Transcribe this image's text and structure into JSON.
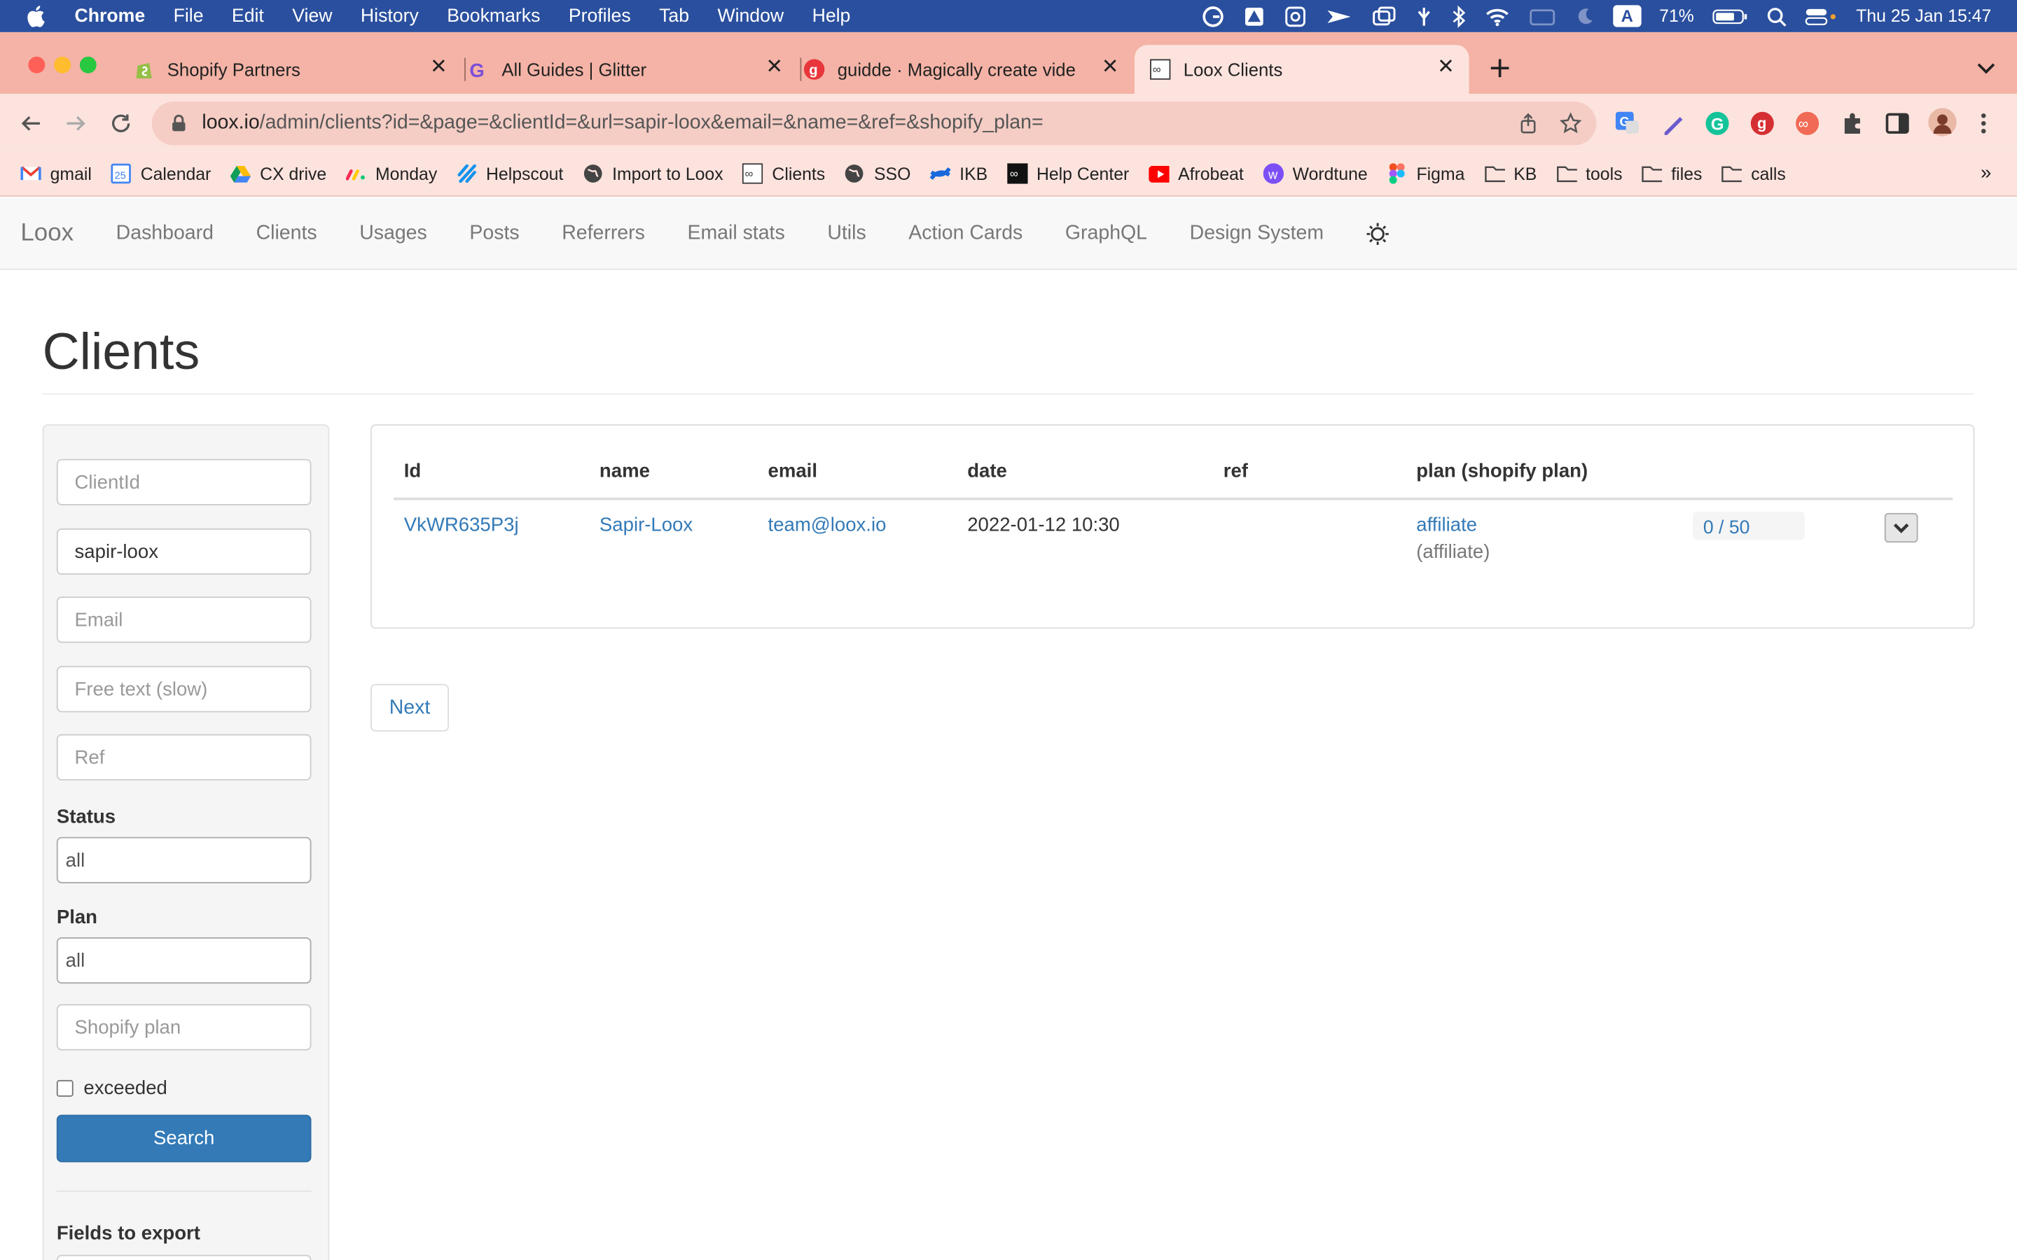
{
  "menubar": {
    "app": "Chrome",
    "items": [
      "File",
      "Edit",
      "View",
      "History",
      "Bookmarks",
      "Profiles",
      "Tab",
      "Window",
      "Help"
    ],
    "battery": "71%",
    "input_source": "A",
    "datetime": "Thu 25 Jan  15:47"
  },
  "tabs": [
    {
      "title": "Shopify Partners",
      "icon": "shopify-icon"
    },
    {
      "title": "All Guides | Glitter",
      "icon": "glitter-icon"
    },
    {
      "title": "guidde · Magically create vide",
      "icon": "guidde-icon"
    },
    {
      "title": "Loox Clients",
      "icon": "loox-icon"
    }
  ],
  "omnibox": {
    "host": "loox.io",
    "path": "/admin/clients?id=&page=&clientId=&url=sapir-loox&email=&name=&ref=&shopify_plan="
  },
  "bookmarks": [
    {
      "label": "gmail",
      "icon": "gmail-icon"
    },
    {
      "label": "Calendar",
      "icon": "calendar-icon"
    },
    {
      "label": "CX drive",
      "icon": "drive-icon"
    },
    {
      "label": "Monday",
      "icon": "monday-icon"
    },
    {
      "label": "Helpscout",
      "icon": "helpscout-icon"
    },
    {
      "label": "Import to Loox",
      "icon": "globe-icon"
    },
    {
      "label": "Clients",
      "icon": "loox-icon"
    },
    {
      "label": "SSO",
      "icon": "globe-icon"
    },
    {
      "label": "IKB",
      "icon": "confluence-icon"
    },
    {
      "label": "Help Center",
      "icon": "loox-icon"
    },
    {
      "label": "Afrobeat",
      "icon": "youtube-icon"
    },
    {
      "label": "Wordtune",
      "icon": "wordtune-icon"
    },
    {
      "label": "Figma",
      "icon": "figma-icon"
    },
    {
      "label": "KB",
      "icon": "folder-icon"
    },
    {
      "label": "tools",
      "icon": "folder-icon"
    },
    {
      "label": "files",
      "icon": "folder-icon"
    },
    {
      "label": "calls",
      "icon": "folder-icon"
    }
  ],
  "bookmarks_overflow": "»",
  "appnav": {
    "brand": "Loox",
    "links": [
      "Dashboard",
      "Clients",
      "Usages",
      "Posts",
      "Referrers",
      "Email stats",
      "Utils",
      "Action Cards",
      "GraphQL",
      "Design System"
    ]
  },
  "page": {
    "title": "Clients"
  },
  "filters": {
    "client_id_placeholder": "ClientId",
    "url_value": "sapir-loox",
    "email_placeholder": "Email",
    "free_text_placeholder": "Free text (slow)",
    "ref_placeholder": "Ref",
    "status_label": "Status",
    "status_value": "all",
    "plan_label": "Plan",
    "plan_value": "all",
    "shopify_plan_placeholder": "Shopify plan",
    "exceeded_label": "exceeded",
    "search_label": "Search",
    "export_label": "Fields to export"
  },
  "table": {
    "headers": [
      "Id",
      "name",
      "email",
      "date",
      "ref",
      "plan (shopify plan)"
    ],
    "rows": [
      {
        "id": "VkWR635P3j",
        "name": "Sapir-Loox",
        "email": "team@loox.io",
        "date": "2022-01-12 10:30",
        "ref": "",
        "plan": "affiliate",
        "shopify_plan": "(affiliate)",
        "usage": "0 / 50"
      }
    ]
  },
  "pagination": {
    "next_label": "Next"
  },
  "colors": {
    "primary": "#337ab7",
    "tabbar": "#f4b3a6",
    "menubar": "#2a4f9e"
  }
}
